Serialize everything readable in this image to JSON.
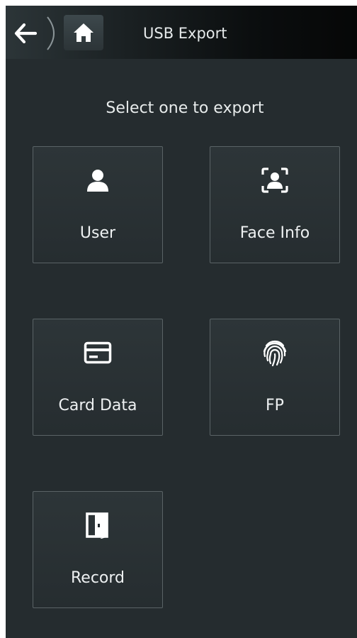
{
  "header": {
    "title": "USB Export",
    "back_icon": "arrow-left-icon",
    "home_icon": "home-icon"
  },
  "prompt": "Select one to export",
  "tiles": [
    {
      "label": "User",
      "icon": "user-icon"
    },
    {
      "label": "Face Info",
      "icon": "face-scan-icon"
    },
    {
      "label": "Card Data",
      "icon": "card-icon"
    },
    {
      "label": "FP",
      "icon": "fingerprint-icon"
    },
    {
      "label": "Record",
      "icon": "door-icon"
    }
  ],
  "colors": {
    "background": "#252c2f",
    "tile_border": "#5a6366",
    "text": "#eef1f2"
  }
}
